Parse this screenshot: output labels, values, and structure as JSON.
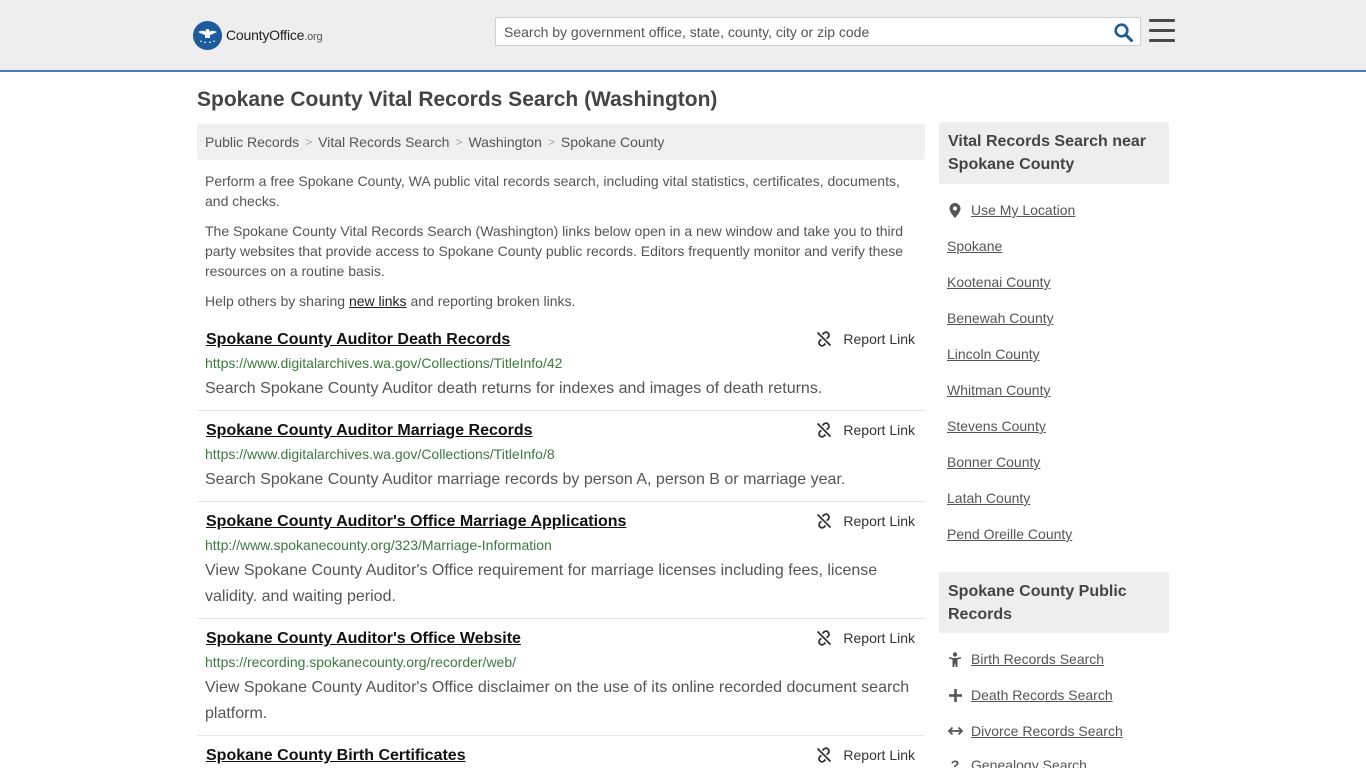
{
  "header": {
    "logo_text_main": "CountyOffice",
    "logo_text_suffix": ".org",
    "search_placeholder": "Search by government office, state, county, city or zip code"
  },
  "page": {
    "title": "Spokane County Vital Records Search (Washington)"
  },
  "breadcrumb": [
    "Public Records",
    "Vital Records Search",
    "Washington",
    "Spokane County"
  ],
  "intro": {
    "p1": "Perform a free Spokane County, WA public vital records search, including vital statistics, certificates, documents, and checks.",
    "p2": "The Spokane County Vital Records Search (Washington) links below open in a new window and take you to third party websites that provide access to Spokane County public records. Editors frequently monitor and verify these resources on a routine basis.",
    "p3_before": "Help others by sharing ",
    "p3_link": "new links",
    "p3_after": " and reporting broken links."
  },
  "report_label": "Report Link",
  "results": [
    {
      "title": "Spokane County Auditor Death Records",
      "url": "https://www.digitalarchives.wa.gov/Collections/TitleInfo/42",
      "desc": "Search Spokane County Auditor death returns for indexes and images of death returns."
    },
    {
      "title": "Spokane County Auditor Marriage Records",
      "url": "https://www.digitalarchives.wa.gov/Collections/TitleInfo/8",
      "desc": "Search Spokane County Auditor marriage records by person A, person B or marriage year."
    },
    {
      "title": "Spokane County Auditor's Office Marriage Applications",
      "url": "http://www.spokanecounty.org/323/Marriage-Information",
      "desc": "View Spokane County Auditor's Office requirement for marriage licenses including fees, license validity. and waiting period."
    },
    {
      "title": "Spokane County Auditor's Office Website",
      "url": "https://recording.spokanecounty.org/recorder/web/",
      "desc": "View Spokane County Auditor's Office disclaimer on the use of its online recorded document search platform."
    },
    {
      "title": "Spokane County Birth Certificates",
      "url": "",
      "desc": ""
    }
  ],
  "sidebar": {
    "nearby_heading": "Vital Records Search near Spokane County",
    "use_location": "Use My Location",
    "nearby": [
      "Spokane",
      "Kootenai County",
      "Benewah County",
      "Lincoln County",
      "Whitman County",
      "Stevens County",
      "Bonner County",
      "Latah County",
      "Pend Oreille County"
    ],
    "public_heading": "Spokane County Public Records",
    "public_links": [
      {
        "label": "Birth Records Search",
        "icon": "baby-icon"
      },
      {
        "label": "Death Records Search",
        "icon": "cross-icon"
      },
      {
        "label": "Divorce Records Search",
        "icon": "split-arrows-icon"
      },
      {
        "label": "Genealogy Search",
        "icon": "question-icon"
      }
    ]
  },
  "colors": {
    "header_bg": "#eeeeee",
    "header_border": "#4a7ab8",
    "url_green": "#3c7a3c",
    "logo_blue": "#1d5a9e",
    "search_icon": "#1d5a9e"
  }
}
